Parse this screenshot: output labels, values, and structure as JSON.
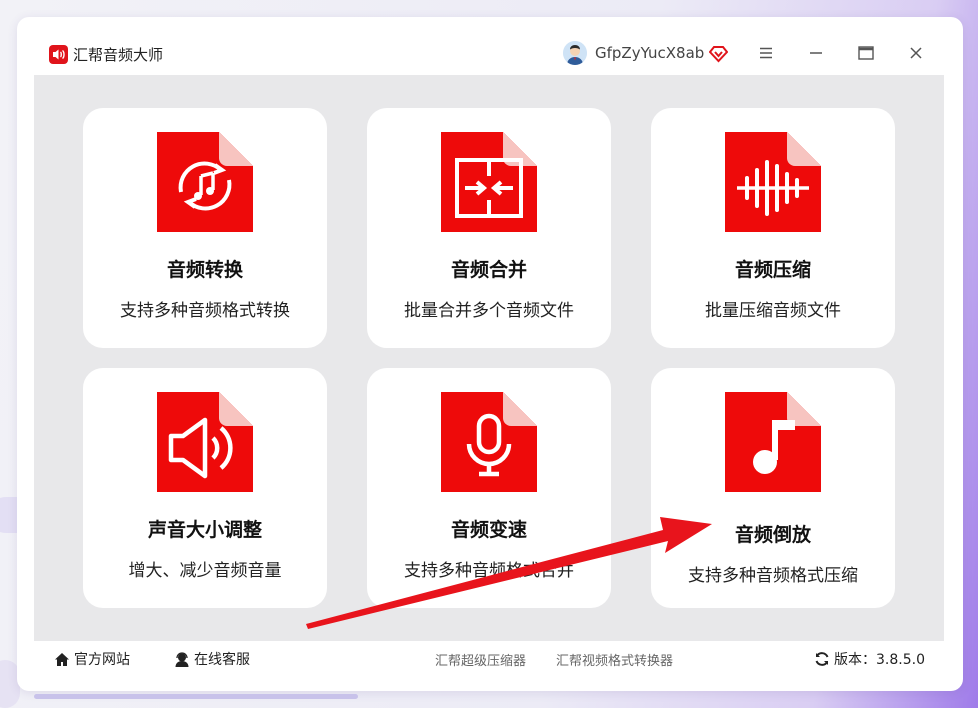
{
  "app": {
    "title": "汇帮音频大师"
  },
  "user": {
    "name": "GfpZyYucX8ab"
  },
  "colors": {
    "accent": "#e0141b",
    "panel": "#e8e8ea",
    "arrow": "#e8141c"
  },
  "cards": [
    {
      "title": "音频转换",
      "desc": "支持多种音频格式转换",
      "icon": "audio-convert-icon"
    },
    {
      "title": "音频合并",
      "desc": "批量合并多个音频文件",
      "icon": "audio-merge-icon"
    },
    {
      "title": "音频压缩",
      "desc": "批量压缩音频文件",
      "icon": "audio-compress-icon"
    },
    {
      "title": "声音大小调整",
      "desc": "增大、减少音频音量",
      "icon": "volume-icon"
    },
    {
      "title": "音频变速",
      "desc": "支持多种音频格式合并",
      "icon": "microphone-icon"
    },
    {
      "title": "音频倒放",
      "desc": "支持多种音频格式压缩",
      "icon": "music-note-icon"
    }
  ],
  "footer": {
    "website": "官方网站",
    "service": "在线客服",
    "links": [
      "汇帮超级压缩器",
      "汇帮视频格式转换器"
    ],
    "version_label": "版本：3.8.5.0"
  }
}
